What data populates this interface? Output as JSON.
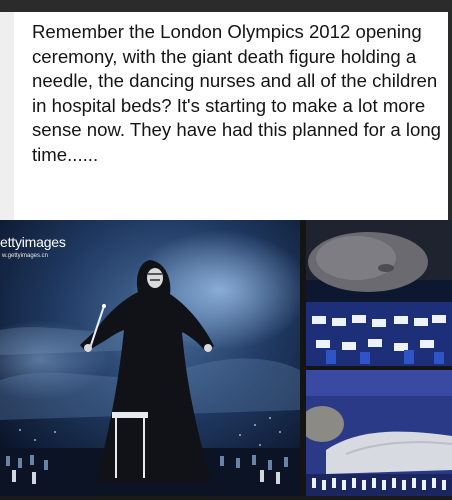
{
  "post": {
    "text": "Remember the London Olympics 2012 opening ceremony, with the giant death figure holding a needle, the dancing nurses and all of the children in hospital beds? It's starting to make a lot more sense now. They have had this planned for a long time......"
  },
  "images": {
    "watermark_brand": "ettyimages",
    "watermark_url": "w.gettyimages.cn"
  }
}
